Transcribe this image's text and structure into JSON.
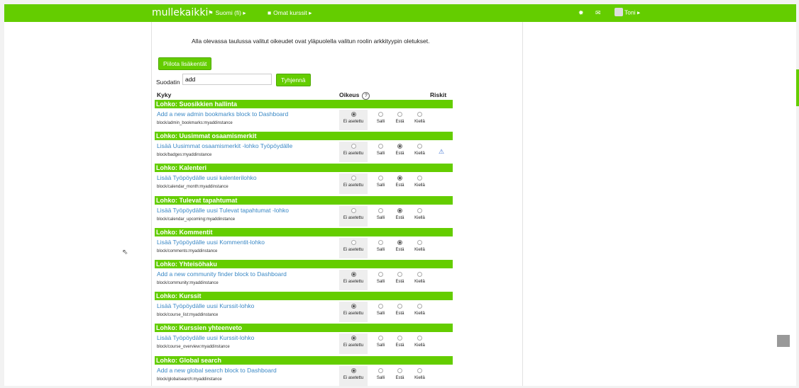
{
  "topbar": {
    "brand": "mullekaikki",
    "language": {
      "icon": "flag-icon",
      "label": "Suomi (fi)",
      "caret": "▸"
    },
    "courses": {
      "icon": "briefcase-icon",
      "label": "Omat kurssit",
      "caret": "▸"
    },
    "notifications_icon": "bell-icon",
    "messages_icon": "envelope-icon",
    "user": {
      "label": "Toni",
      "caret": "▸"
    }
  },
  "intro": "Alla olevassa taulussa valitut oikeudet ovat yläpuolella valitun roolin arkkityypin oletukset.",
  "hide_fields_button": "Piilota lisäkentät",
  "filter": {
    "label": "Suodatin",
    "value": "add",
    "clear_button": "Tyhjennä"
  },
  "table": {
    "col_capability": "Kyky",
    "col_permission": "Oikeus",
    "col_help": "?",
    "col_risks": "Riskit",
    "options": [
      "Ei asetettu",
      "Salli",
      "Estä",
      "Kiellä"
    ],
    "sections": [
      {
        "title": "Lohko: Suosikkien hallinta",
        "label": "Add a new admin bookmarks block to Dashboard",
        "code": "block/admin_bookmarks:myaddinstance",
        "selected": 0,
        "risk": ""
      },
      {
        "title": "Lohko: Uusimmat osaamismerkit",
        "label": "Lisää Uusimmat osaamismerkit -lohko Työpöydälle",
        "code": "block/badges:myaddinstance",
        "selected": 2,
        "risk": "⚠"
      },
      {
        "title": "Lohko: Kalenteri",
        "label": "Lisää Työpöydälle uusi kalenterilohko",
        "code": "block/calendar_month:myaddinstance",
        "selected": 2,
        "risk": ""
      },
      {
        "title": "Lohko: Tulevat tapahtumat",
        "label": "Lisää Työpöydälle uusi Tulevat tapahtumat -lohko",
        "code": "block/calendar_upcoming:myaddinstance",
        "selected": 2,
        "risk": ""
      },
      {
        "title": "Lohko: Kommentit",
        "label": "Lisää Työpöydälle uusi Kommentit-lohko",
        "code": "block/comments:myaddinstance",
        "selected": 2,
        "risk": ""
      },
      {
        "title": "Lohko: Yhteisöhaku",
        "label": "Add a new community finder block to Dashboard",
        "code": "block/community:myaddinstance",
        "selected": 0,
        "risk": ""
      },
      {
        "title": "Lohko: Kurssit",
        "label": "Lisää Työpöydälle uusi Kurssit-lohko",
        "code": "block/course_list:myaddinstance",
        "selected": 0,
        "risk": ""
      },
      {
        "title": "Lohko: Kurssien yhteenveto",
        "label": "Lisää Työpöydälle uusi Kurssit-lohko",
        "code": "block/course_overview:myaddinstance",
        "selected": 0,
        "risk": ""
      },
      {
        "title": "Lohko: Global search",
        "label": "Add a new global search block to Dashboard",
        "code": "block/globalsearch:myaddinstance",
        "selected": 0,
        "risk": ""
      }
    ]
  },
  "colors": {
    "accent": "#64cd00",
    "link": "#3a88c5"
  }
}
